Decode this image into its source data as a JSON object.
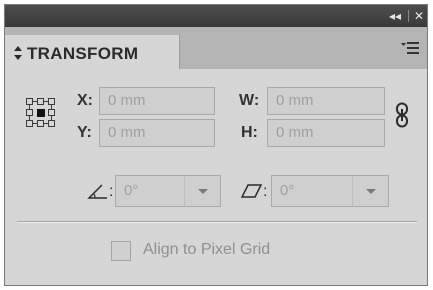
{
  "window": {
    "collapse_label": "◂◂",
    "close_label": "✕"
  },
  "panel": {
    "title": "TRANSFORM",
    "icons": {
      "title_arrows": "up-down-arrows-icon",
      "menu": "panel-menu-icon",
      "reference_point": "reference-point-icon",
      "link": "constrain-proportions-icon",
      "rotate": "rotate-angle-icon",
      "shear": "shear-angle-icon"
    }
  },
  "fields": {
    "x": {
      "label": "X:",
      "value": "0 mm"
    },
    "y": {
      "label": "Y:",
      "value": "0 mm"
    },
    "w": {
      "label": "W:",
      "value": "0 mm"
    },
    "h": {
      "label": "H:",
      "value": "0 mm"
    }
  },
  "rotate": {
    "colon": ":",
    "value": "0°"
  },
  "shear": {
    "colon": ":",
    "value": "0°"
  },
  "checkbox": {
    "label": "Align to Pixel Grid",
    "checked": false
  },
  "colors": {
    "panel_bg": "#d6d6d6",
    "titlebar_bg": "#3a3a3a",
    "tabrow_bg": "#b4b4b4",
    "disabled_text": "#a0a0a0"
  }
}
